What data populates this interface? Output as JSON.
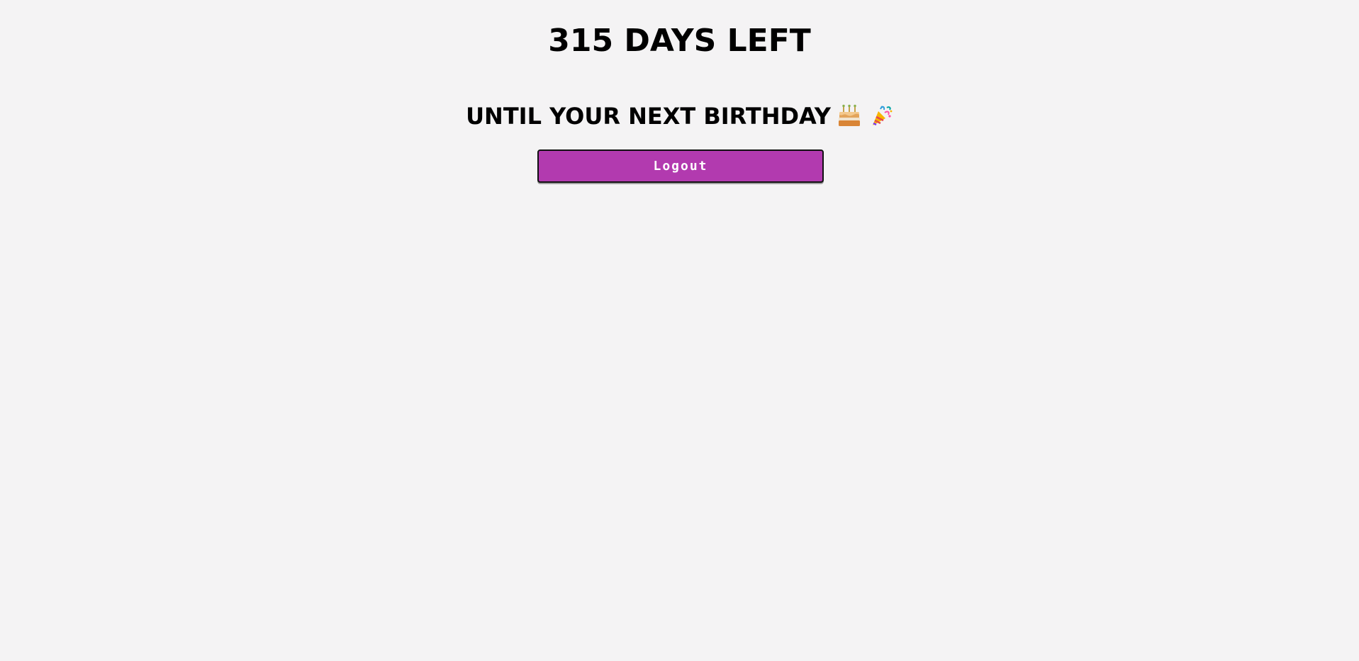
{
  "countdown": {
    "text": "315 DAYS LEFT"
  },
  "subtitle": {
    "text": "UNTIL YOUR NEXT BIRTHDAY",
    "icons": [
      "birthday-cake-icon",
      "party-popper-icon"
    ]
  },
  "actions": {
    "logout_label": "Logout"
  },
  "colors": {
    "background": "#f4f3f4",
    "button": "#b23aaf",
    "button_text": "#ffffff",
    "text": "#000000"
  }
}
